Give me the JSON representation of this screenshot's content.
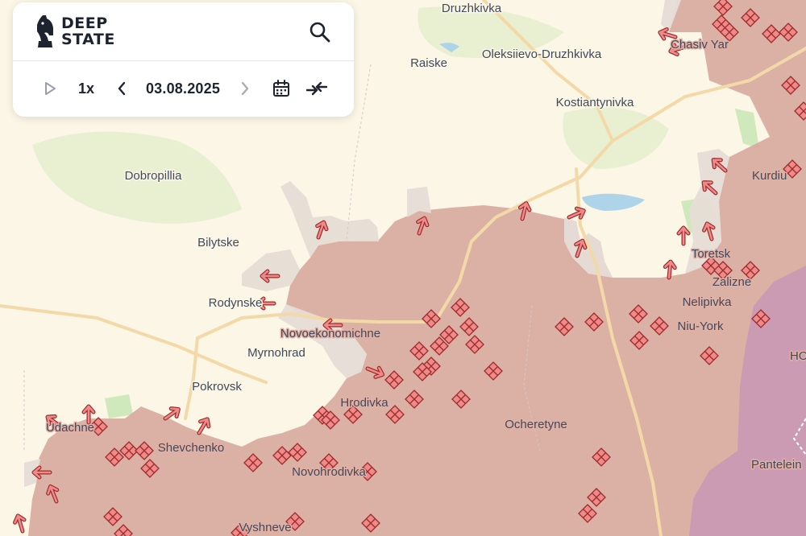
{
  "brand": {
    "line1": "DEEP",
    "line2": "STATE",
    "logo_icon": "knight-chess-icon"
  },
  "toolbar": {
    "search_icon": "search-icon",
    "play_icon": "play-icon",
    "speed": "1x",
    "prev_icon": "chevron-left-icon",
    "date": "03.08.2025",
    "next_icon": "chevron-right-icon",
    "calendar_icon": "calendar-icon",
    "compare_icon": "arrows-compare-icon"
  },
  "map": {
    "colors": {
      "background": "#fbf6e6",
      "occupied": "#d9aaa0",
      "gray_zone": "#e6ddd6",
      "other_zone": "#c999b6",
      "water": "#aed4ea",
      "road": "#f3d9a8",
      "forest": "#cfe8bc",
      "marker": "#ee8a8a",
      "marker_stroke": "#9e2a2a"
    },
    "places": [
      "Druzhkivka",
      "Raiske",
      "Oleksiievo-Druzhkivka",
      "Chasiv Yar",
      "Kostiantynivka",
      "Dobropillia",
      "Kurdiu",
      "Bilytske",
      "Toretsk",
      "Zalizne",
      "Rodynske",
      "Nelipivka",
      "Novoekonomichne",
      "Niu-York",
      "Myrnohrad",
      "HO",
      "Pokrovsk",
      "Hrodivka",
      "Ocheretyne",
      "Udachne",
      "Shevchenko",
      "Novohrodivka",
      "Pantelein",
      "Vyshneve"
    ]
  }
}
